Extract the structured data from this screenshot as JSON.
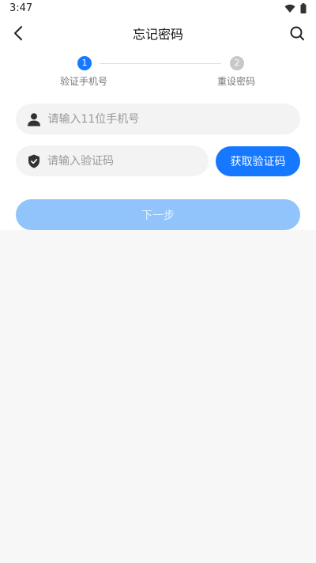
{
  "status_bar": {
    "time": "3:47",
    "icons": [
      "wifi-icon",
      "battery-icon"
    ]
  },
  "header": {
    "title": "忘记密码",
    "back_icon": "chevron-left-icon",
    "search_icon": "search-icon"
  },
  "steps": [
    {
      "number": "1",
      "label": "验证手机号",
      "active": true
    },
    {
      "number": "2",
      "label": "重设密码",
      "active": false
    }
  ],
  "form": {
    "phone": {
      "placeholder": "请输入11位手机号",
      "value": "",
      "icon": "user-icon"
    },
    "code": {
      "placeholder": "请输入验证码",
      "value": "",
      "icon": "shield-check-icon"
    },
    "get_code_label": "获取验证码",
    "next_label": "下一步"
  },
  "colors": {
    "accent": "#1677ff",
    "disabled_button": "#91c4fb",
    "input_bg": "#f3f3f3",
    "page_bg": "#f7f7f7"
  }
}
